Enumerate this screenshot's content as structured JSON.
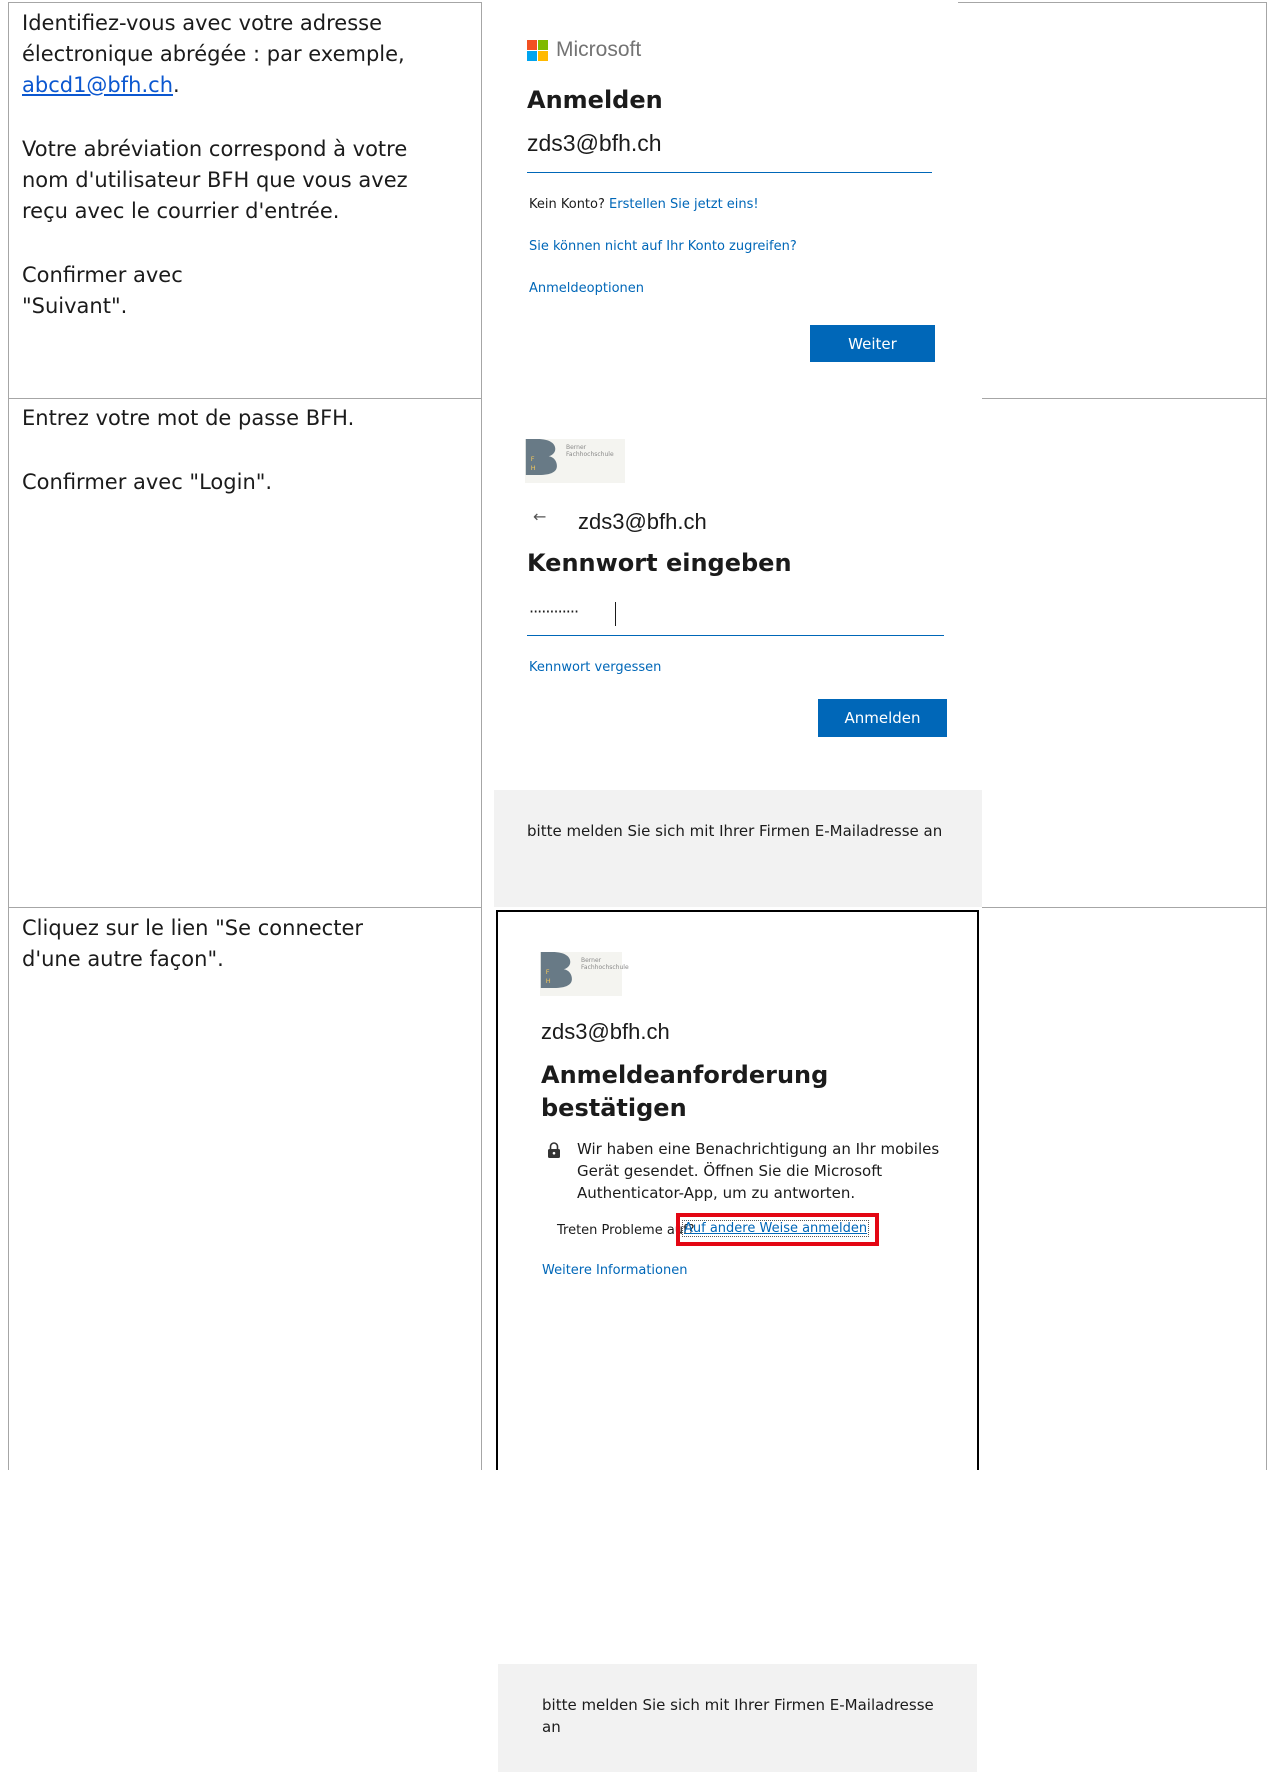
{
  "rows": [
    {
      "instructions": {
        "line1": "Identifiez-vous avec votre adresse",
        "line2": "électronique abrégée : par exemple,",
        "email_link": "abcd1@bfh.ch",
        "email_suffix": ".",
        "para2_line1": "Votre abréviation correspond à votre",
        "para2_line2": "nom d'utilisateur BFH que vous avez",
        "para2_line3": "reçu avec le courrier d'entrée.",
        "para3_line1": "Confirmer avec",
        "para3_line2": "\"Suivant\"."
      },
      "screen": {
        "brand": "Microsoft",
        "title": "Anmelden",
        "email_value": "zds3@bfh.ch",
        "no_account_text": "Kein Konto?",
        "create_link": "Erstellen Sie jetzt eins!",
        "cant_access_link": "Sie können nicht auf Ihr Konto zugreifen?",
        "options_link": "Anmeldeoptionen",
        "next_button": "Weiter"
      }
    },
    {
      "instructions": {
        "line1": "Entrez votre mot de passe BFH.",
        "line2": "Confirmer avec \"Login\"."
      },
      "screen": {
        "logo_text_1": "Berner",
        "logo_text_2": "Fachhochschule",
        "logo_letters": [
          "F",
          "H"
        ],
        "back_arrow": "←",
        "email": "zds3@bfh.ch",
        "title": "Kennwort eingeben",
        "password_mask": "············",
        "forgot_link": "Kennwort vergessen",
        "signin_button": "Anmelden",
        "footer_text": "bitte melden Sie sich mit Ihrer Firmen E-Mailadresse an"
      }
    },
    {
      "instructions": {
        "line1": "Cliquez sur le lien \"Se connecter",
        "line2": "d'une autre façon\"."
      },
      "screen": {
        "logo_text_1": "Berner",
        "logo_text_2": "Fachhochschule",
        "logo_letters": [
          "F",
          "H"
        ],
        "email": "zds3@bfh.ch",
        "title_line1": "Anmeldeanforderung",
        "title_line2": "bestätigen",
        "notice_line1": "Wir haben eine Benachrichtigung an Ihr mobiles",
        "notice_line2": "Gerät gesendet. Öffnen Sie die Microsoft",
        "notice_line3": "Authenticator-App, um zu antworten.",
        "problem_text": "Treten Probleme auf?",
        "other_way_link": "Auf andere Weise anmelden",
        "more_info_link": "Weitere Informationen",
        "footer_text": "bitte melden Sie sich mit Ihrer Firmen E-Mailadresse an"
      }
    }
  ],
  "colors": {
    "link": "#0067b8",
    "button": "#0067b8",
    "highlight": "#e30613",
    "footer_bg": "#f2f2f2"
  }
}
